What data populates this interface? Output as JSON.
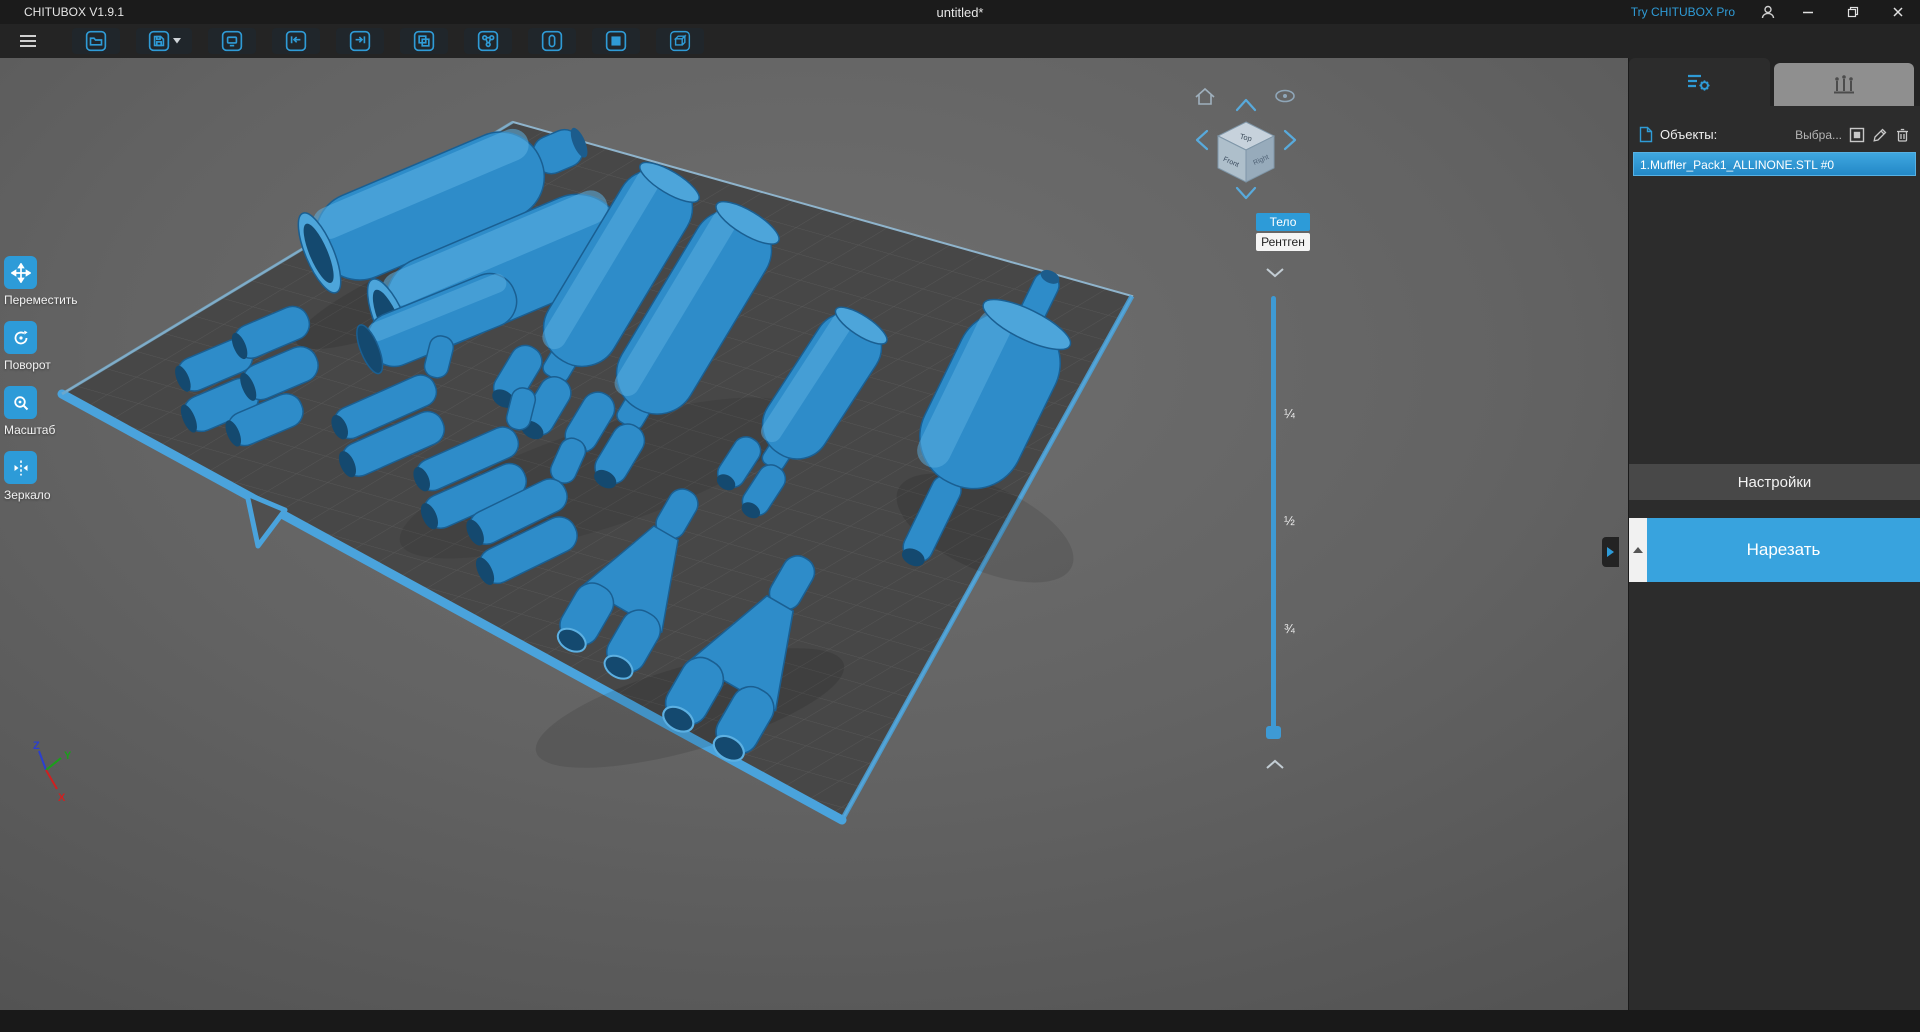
{
  "window": {
    "app_title": "CHITUBOX V1.9.1",
    "doc_title": "untitled*",
    "pro_link": "Try CHITUBOX Pro"
  },
  "toolbar_icons": [
    "menu",
    "open-file",
    "save",
    "screenshot",
    "undo",
    "redo",
    "copy",
    "auto-arrange",
    "hollow",
    "dig-hole",
    "resin-box"
  ],
  "tools": [
    {
      "id": "move",
      "label": "Переместить"
    },
    {
      "id": "rotate",
      "label": "Поворот"
    },
    {
      "id": "scale",
      "label": "Масштаб"
    },
    {
      "id": "mirror",
      "label": "Зеркало"
    }
  ],
  "viewport": {
    "cube": {
      "top": "Top",
      "front": "Front",
      "right": "Right"
    },
    "modes": {
      "body": "Тело",
      "xray": "Рентген"
    },
    "slider": {
      "q1": "¼",
      "q2": "½",
      "q3": "¾"
    },
    "axes": {
      "x": "X",
      "y": "Y",
      "z": "Z"
    }
  },
  "panel": {
    "objects_label": "Объекты:",
    "selected_hint": "Выбра...",
    "item": "1.Muffler_Pack1_ALLINONE.STL #0",
    "settings": "Настройки",
    "slice": "Нарезать"
  },
  "colors": {
    "accent": "#2f9bd6",
    "selection": "#2d9bd8",
    "model": "#2e8cc9"
  }
}
